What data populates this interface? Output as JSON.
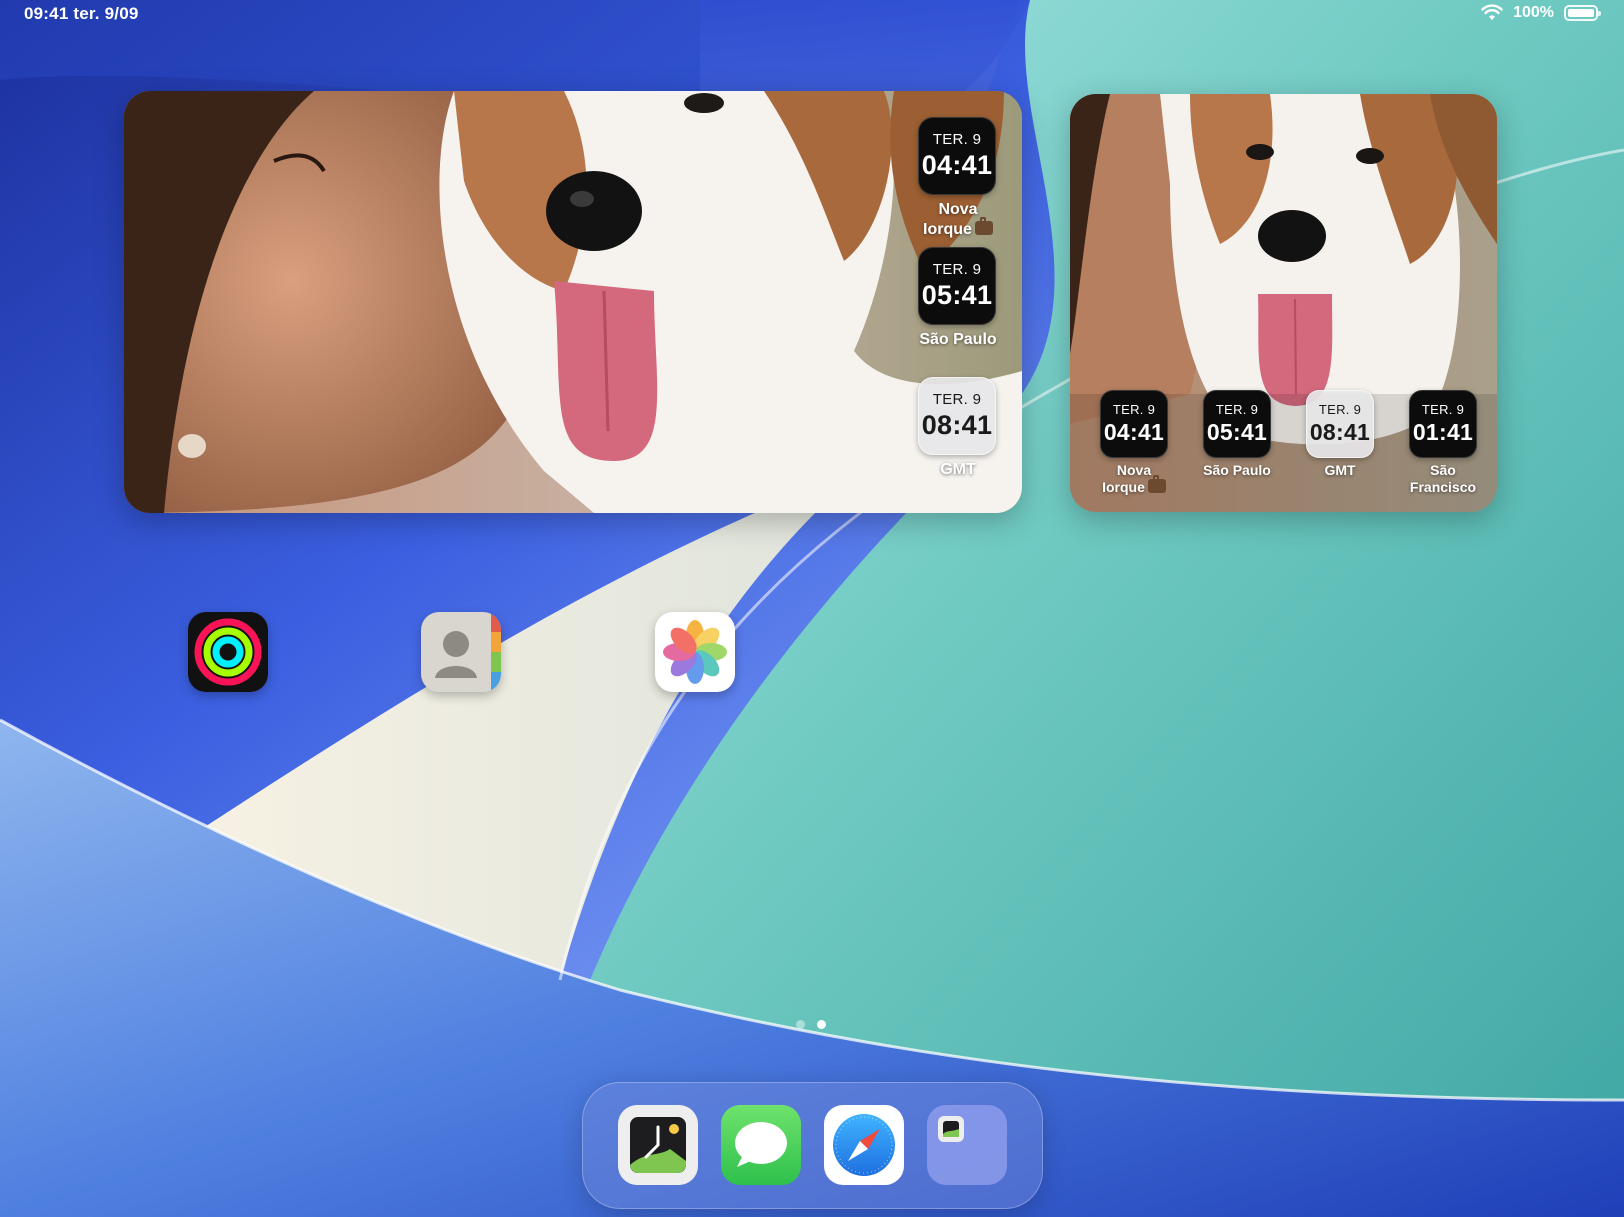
{
  "status_bar": {
    "time_date": "09:41 ter. 9/09",
    "battery_text": "100%"
  },
  "widgets": {
    "large": {
      "clocks": [
        {
          "day": "TER. 9",
          "time": "04:41",
          "city": "Nova Iorque",
          "style": "dark",
          "briefcase": true
        },
        {
          "day": "TER. 9",
          "time": "05:41",
          "city": "São Paulo",
          "style": "dark",
          "briefcase": false
        },
        {
          "day": "TER. 9",
          "time": "08:41",
          "city": "GMT",
          "style": "light",
          "briefcase": false
        }
      ]
    },
    "medium": {
      "clocks": [
        {
          "day": "TER. 9",
          "time": "04:41",
          "city": "Nova Iorque",
          "style": "dark",
          "briefcase": true
        },
        {
          "day": "TER. 9",
          "time": "05:41",
          "city": "São Paulo",
          "style": "dark",
          "briefcase": false
        },
        {
          "day": "TER. 9",
          "time": "08:41",
          "city": "GMT",
          "style": "light",
          "briefcase": false
        },
        {
          "day": "TER. 9",
          "time": "01:41",
          "city": "São Francisco",
          "style": "dark",
          "briefcase": false
        }
      ]
    }
  },
  "home_apps": [
    {
      "icon": "activity-icon"
    },
    {
      "icon": "contacts-icon"
    },
    {
      "icon": "photos-icon"
    }
  ],
  "page_dots": {
    "count": 2,
    "active": 1
  },
  "dock_apps": [
    {
      "icon": "clock-photo-app-icon"
    },
    {
      "icon": "messages-icon"
    },
    {
      "icon": "safari-icon"
    },
    {
      "icon": "app-folder-icon"
    }
  ],
  "colors": {
    "wallpaper_blue": "#2a46c8",
    "wallpaper_teal": "#5bbcb4",
    "wallpaper_cream": "#ece8da",
    "dock_tint": "#7a8cdc",
    "clock_dark": "#0c0c0d",
    "clock_light": "#e6e6e8"
  }
}
